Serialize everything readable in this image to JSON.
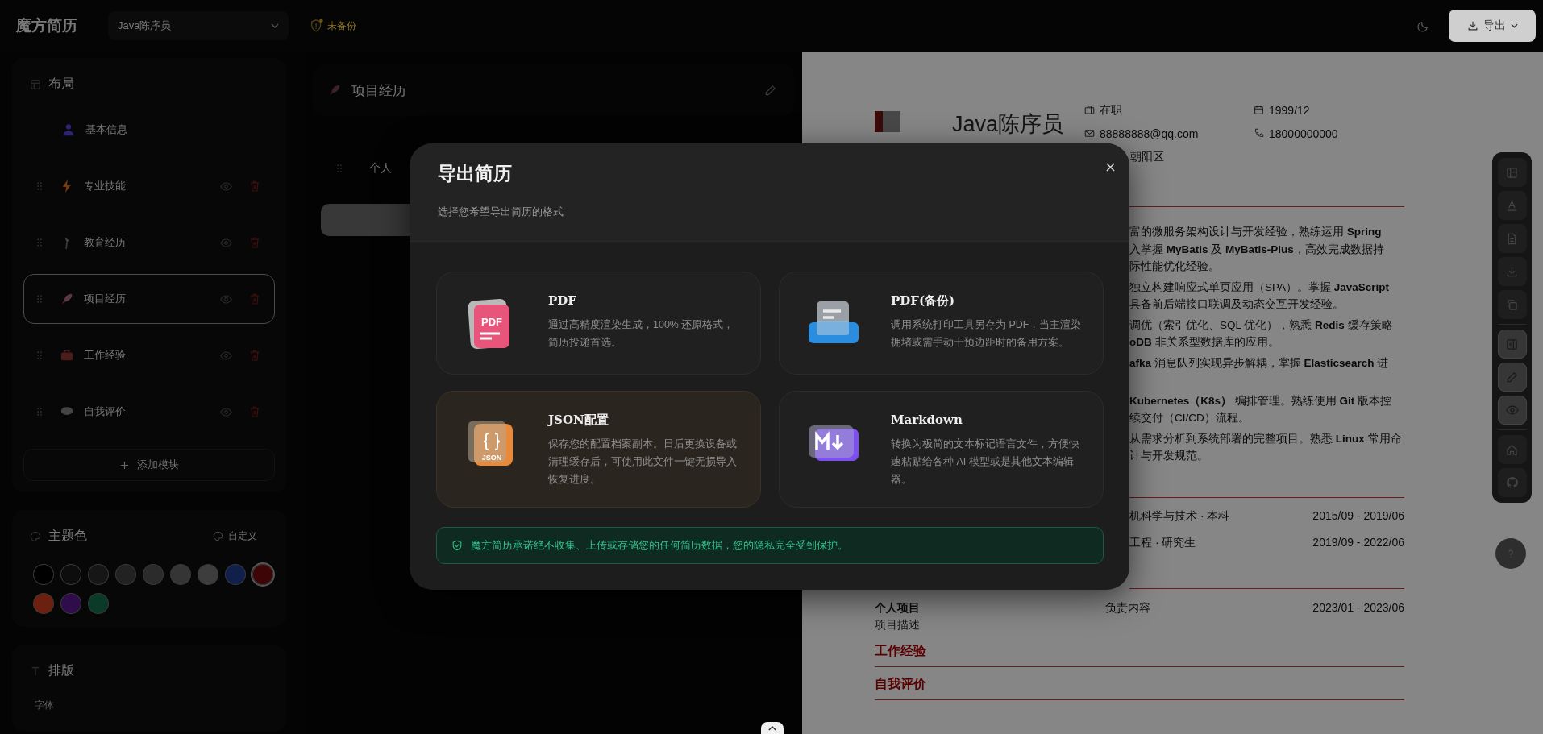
{
  "header": {
    "logo": "魔方简历",
    "resume_select": {
      "value": "Java陈序员"
    },
    "backup_status": "未备份",
    "export_button": "导出"
  },
  "layout_panel": {
    "title": "布局",
    "modules": [
      {
        "kind": "fixed",
        "label": "基本信息",
        "selected": false
      },
      {
        "kind": "movable",
        "label": "专业技能",
        "selected": false
      },
      {
        "kind": "movable",
        "label": "教育经历",
        "selected": false
      },
      {
        "kind": "movable",
        "label": "项目经历",
        "selected": true
      },
      {
        "kind": "movable",
        "label": "工作经验",
        "selected": false
      },
      {
        "kind": "movable",
        "label": "自我评价",
        "selected": false
      }
    ],
    "add_button": "添加模块"
  },
  "theme_panel": {
    "title": "主题色",
    "custom_button": "自定义",
    "colors": [
      {
        "color": "#000000",
        "selected": false
      },
      {
        "color": "#0d0d0d",
        "selected": false
      },
      {
        "color": "#161616",
        "selected": false
      },
      {
        "color": "#222222",
        "selected": false
      },
      {
        "color": "#2b2b2b",
        "selected": false
      },
      {
        "color": "#353535",
        "selected": false
      },
      {
        "color": "#3d3d3d",
        "selected": false
      },
      {
        "color": "#10204a",
        "selected": false
      },
      {
        "color": "#3d0505",
        "selected": true
      },
      {
        "color": "#6b2010",
        "selected": false
      },
      {
        "color": "#2f0c4a",
        "selected": false
      },
      {
        "color": "#0b3a28",
        "selected": false
      }
    ]
  },
  "typography_panel": {
    "title": "排版",
    "font_label": "字体"
  },
  "editor": {
    "title": "项目经历",
    "items": [
      {
        "label": "个人"
      }
    ]
  },
  "preview": {
    "name": "Java陈序员",
    "info": [
      {
        "kind": "text",
        "text": "在职"
      },
      {
        "kind": "text",
        "text": "1999/12"
      },
      {
        "kind": "link",
        "text": "88888888@qq.com"
      },
      {
        "kind": "text",
        "text": "18000000000"
      },
      {
        "kind": "text",
        "text": "朝阳区"
      }
    ],
    "skills": [
      {
        "lines": [
          "富的微服务架构设计与开发经验，熟练运用 **Spring**",
          "入掌握 **MyBatis** 及 **MyBatis-Plus**，高效完成数据持",
          "际性能优化经验。"
        ]
      },
      {
        "lines": [
          "独立构建响应式单页应用（SPA）。掌握 **JavaScript**",
          "具备前后端接口联调及动态交互开发经验。"
        ]
      },
      {
        "lines": [
          "调优（索引优化、SQL 优化），熟悉 **Redis** 缓存策略",
          "**oDB** 非关系型数据库的应用。"
        ]
      },
      {
        "lines": [
          "**afka** 消息队列实现异步解耦，掌握 **Elasticsearch** 进"
        ]
      },
      {
        "lines": [
          "**Kubernetes（K8s）** 编排管理。熟练使用 **Git** 版本控",
          "续交付（CI/CD）流程。"
        ]
      },
      {
        "lines": [
          "从需求分析到系统部署的完整项目。熟悉 **Linux** 常用命",
          "计与开发规范。"
        ]
      }
    ],
    "education": [
      {
        "major": "机科学与技术 · 本科",
        "period": "2015/09 - 2019/06"
      },
      {
        "major": "工程 · 研究生",
        "period": "2019/09 - 2022/06"
      }
    ],
    "projects": [
      {
        "name": "个人项目",
        "role": "负责内容",
        "period": "2023/01 - 2023/06",
        "description": "项目描述"
      }
    ],
    "sections": [
      {
        "title": "工作经验"
      },
      {
        "title": "自我评价"
      }
    ]
  },
  "export_dialog": {
    "title": "导出简历",
    "subtitle": "选择您希望导出简历的格式",
    "formats": [
      {
        "kind": "pdf",
        "icon_label": "PDF",
        "title": "PDF",
        "description": "通过高精度渲染生成，100% 还原格式，简历投递首选。",
        "selected": false
      },
      {
        "kind": "print",
        "title": "PDF(备份)",
        "description": "调用系统打印工具另存为 PDF，当主渲染拥堵或需手动干预边距时的备用方案。",
        "selected": false
      },
      {
        "kind": "json",
        "icon_label": "JSON",
        "title": "JSON配置",
        "description": "保存您的配置档案副本。日后更换设备或清理缓存后，可使用此文件一键无损导入恢复进度。",
        "selected": true
      },
      {
        "kind": "markdown",
        "title": "Markdown",
        "description": "转换为极简的文本标记语言文件，方便快速粘贴给各种 AI 模型或是其他文本编辑器。",
        "selected": false
      }
    ],
    "privacy_note": "魔方简历承诺绝不收集、上传或存储您的任何简历数据，您的隐私完全受到保护。"
  }
}
